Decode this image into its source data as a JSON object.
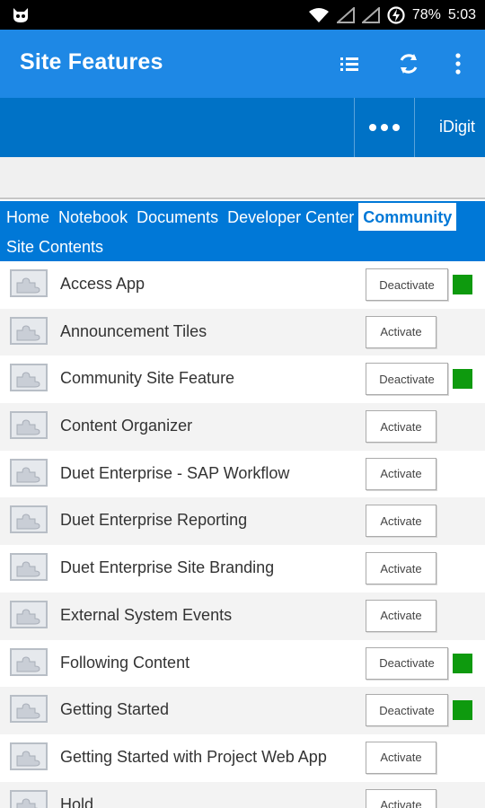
{
  "status_bar": {
    "battery": "78%",
    "time": "5:03"
  },
  "app_bar": {
    "title": "Site Features"
  },
  "suite_bar": {
    "user": "iDigit"
  },
  "nav": {
    "items": [
      {
        "label": "Home",
        "active": false
      },
      {
        "label": "Notebook",
        "active": false
      },
      {
        "label": "Documents",
        "active": false
      },
      {
        "label": "Developer Center",
        "active": false
      },
      {
        "label": "Community",
        "active": true
      }
    ],
    "second_row": "Site Contents"
  },
  "features": [
    {
      "name": "Access App",
      "button": "Deactivate",
      "active": true
    },
    {
      "name": "Announcement Tiles",
      "button": "Activate",
      "active": false
    },
    {
      "name": "Community Site Feature",
      "button": "Deactivate",
      "active": true
    },
    {
      "name": "Content Organizer",
      "button": "Activate",
      "active": false
    },
    {
      "name": "Duet Enterprise - SAP Workflow",
      "button": "Activate",
      "active": false
    },
    {
      "name": "Duet Enterprise Reporting",
      "button": "Activate",
      "active": false
    },
    {
      "name": "Duet Enterprise Site Branding",
      "button": "Activate",
      "active": false
    },
    {
      "name": "External System Events",
      "button": "Activate",
      "active": false
    },
    {
      "name": "Following Content",
      "button": "Deactivate",
      "active": true
    },
    {
      "name": "Getting Started",
      "button": "Deactivate",
      "active": true
    },
    {
      "name": "Getting Started with Project Web App",
      "button": "Activate",
      "active": false
    },
    {
      "name": "Hold",
      "button": "Activate",
      "active": false
    }
  ],
  "colors": {
    "app_bar": "#1e88e5",
    "suite_bar": "#0072c6",
    "nav": "#0078d7",
    "active_status": "#0e9a0e"
  }
}
